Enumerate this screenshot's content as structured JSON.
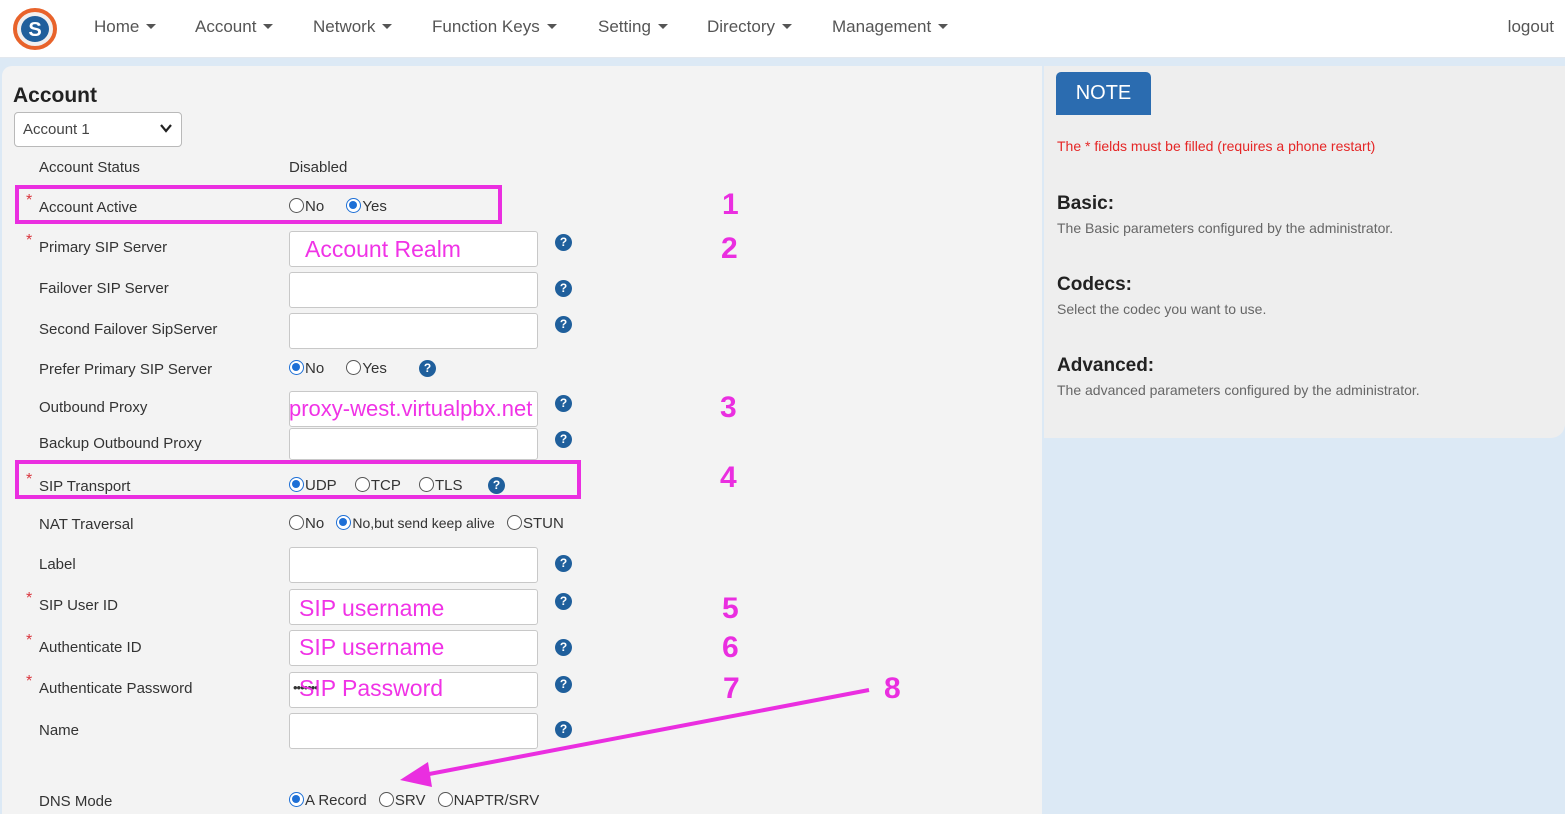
{
  "nav": {
    "items": [
      "Home",
      "Account",
      "Network",
      "Function Keys",
      "Setting",
      "Directory",
      "Management"
    ],
    "logout": "logout"
  },
  "account": {
    "title": "Account",
    "selector_value": "Account 1",
    "status_label": "Account Status",
    "status_value": "Disabled",
    "active_label": "Account Active",
    "active_options": [
      "No",
      "Yes"
    ],
    "primary_label": "Primary SIP Server",
    "primary_value": "Account Realm",
    "failover_label": "Failover SIP Server",
    "second_failover_label": "Second Failover SipServer",
    "prefer_label": "Prefer Primary SIP Server",
    "prefer_options": [
      "No",
      "Yes"
    ],
    "outbound_label": "Outbound Proxy",
    "outbound_value": "proxy-west.virtualpbx.net",
    "backup_label": "Backup Outbound Proxy",
    "transport_label": "SIP Transport",
    "transport_options": [
      "UDP",
      "TCP",
      "TLS"
    ],
    "nat_label": "NAT Traversal",
    "nat_options": [
      "No",
      "No,but send keep alive",
      "STUN"
    ],
    "label_label": "Label",
    "userid_label": "SIP User ID",
    "userid_value": "SIP username",
    "authid_label": "Authenticate ID",
    "authid_value": "SIP username",
    "password_label": "Authenticate Password",
    "password_value": "SIP Password",
    "password_mask": "•••••••",
    "name_label": "Name",
    "dns_label": "DNS Mode",
    "dns_options": [
      "A Record",
      "SRV",
      "NAPTR/SRV"
    ]
  },
  "annotations": [
    "1",
    "2",
    "3",
    "4",
    "5",
    "6",
    "7",
    "8"
  ],
  "note": {
    "button": "NOTE",
    "required": "The * fields must be filled (requires a phone restart)",
    "basic_title": "Basic:",
    "basic_text": "The Basic parameters configured by the administrator.",
    "codecs_title": "Codecs:",
    "codecs_text": "Select the codec you want to use.",
    "advanced_title": "Advanced:",
    "advanced_text": "The advanced parameters configured by the administrator."
  },
  "colors": {
    "accent": "#2b6cb0",
    "highlight": "#ea2ee0",
    "required": "#e52626"
  }
}
